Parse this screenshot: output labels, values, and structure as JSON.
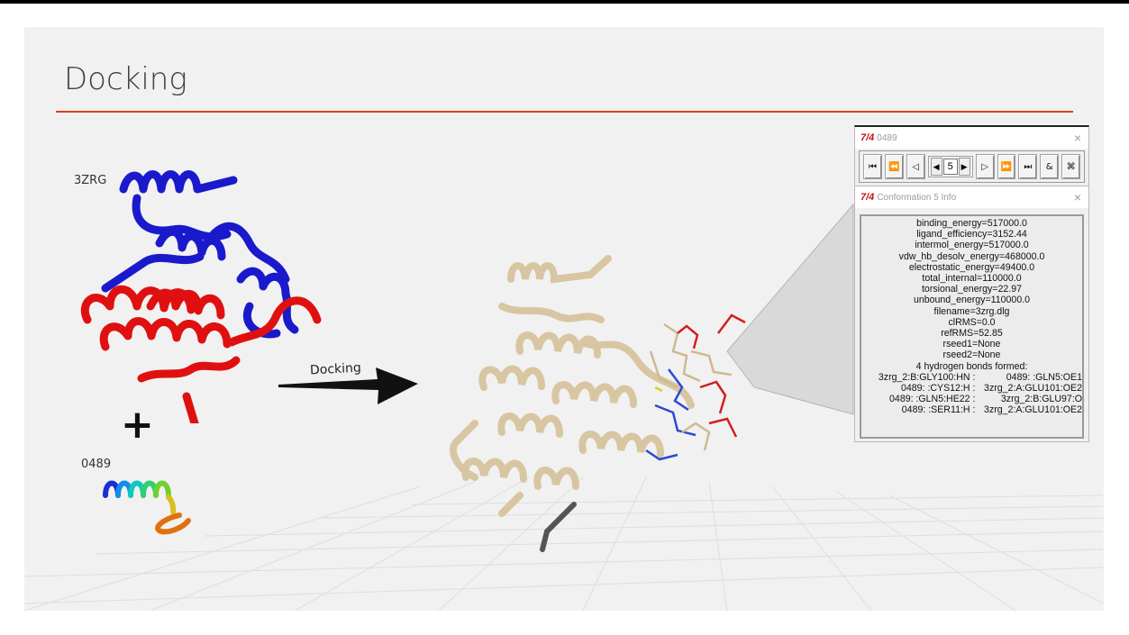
{
  "slide": {
    "title": "Docking",
    "receptor_label": "3ZRG",
    "plus_symbol": "+",
    "ligand_label": "0489",
    "arrow_label": "Docking",
    "accent_color": "#d9401c",
    "receptor_colors": {
      "top": "#1a1acc",
      "bottom": "#e01010"
    },
    "complex_color": "#d8c6a2"
  },
  "player_window": {
    "logo": "7/4",
    "title": "0489",
    "close": "×",
    "buttons": [
      {
        "name": "first-button",
        "glyph": "⏮"
      },
      {
        "name": "fast-back-button",
        "glyph": "⏪"
      },
      {
        "name": "play-reverse-button",
        "glyph": "◁"
      }
    ],
    "frame": {
      "prev": "◀",
      "value": "5",
      "next": "▶"
    },
    "buttons_right": [
      {
        "name": "play-button",
        "glyph": "▷"
      },
      {
        "name": "fast-forward-button",
        "glyph": "⏩"
      },
      {
        "name": "last-button",
        "glyph": "⏭"
      },
      {
        "name": "settings-button",
        "glyph": "&"
      },
      {
        "name": "close-player-button",
        "glyph": "⌘"
      }
    ]
  },
  "info_window": {
    "logo": "7/4",
    "title": "Conformation 5 Info",
    "close": "×",
    "lines": [
      "binding_energy=517000.0",
      "ligand_efficiency=3152.44",
      "intermol_energy=517000.0",
      "vdw_hb_desolv_energy=468000.0",
      "electrostatic_energy=49400.0",
      "total_internal=110000.0",
      "torsional_energy=22.97",
      "unbound_energy=110000.0",
      "filename=3zrg.dlg",
      "clRMS=0.0",
      "refRMS=52.85",
      "rseed1=None",
      "rseed2=None",
      "4 hydrogen bonds formed:"
    ],
    "hbonds": [
      {
        "left": "3zrg_2:B:GLY100:HN :",
        "right": "0489: :GLN5:OE1"
      },
      {
        "left": "0489: :CYS12:H :",
        "right": "3zrg_2:A:GLU101:OE2"
      },
      {
        "left": "0489: :GLN5:HE22 :",
        "right": "3zrg_2:B:GLU97:O"
      },
      {
        "left": "0489: :SER11:H :",
        "right": "3zrg_2:A:GLU101:OE2"
      }
    ]
  }
}
